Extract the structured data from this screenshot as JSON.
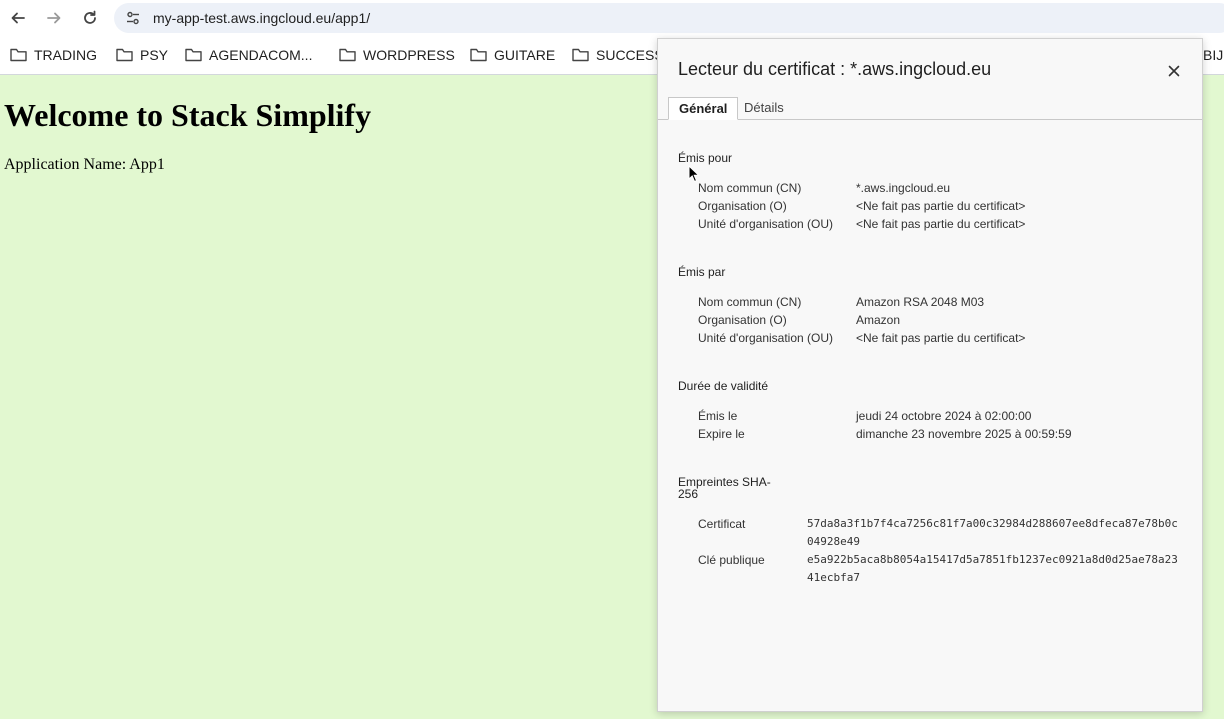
{
  "browser": {
    "url": "my-app-test.aws.ingcloud.eu/app1/",
    "icons": {
      "back": "back-arrow-icon",
      "forward": "forward-arrow-icon",
      "reload": "reload-icon",
      "site_info": "site-info-tune-icon"
    }
  },
  "bookmarks": [
    {
      "label": "TRADING"
    },
    {
      "label": "PSY"
    },
    {
      "label": "AGENDACOM..."
    },
    {
      "label": "WORDPRESS"
    },
    {
      "label": "GUITARE"
    },
    {
      "label": "SUCCESS"
    },
    {
      "label": "BIJ"
    }
  ],
  "page": {
    "heading": "Welcome to Stack Simplify",
    "app_name": "Application Name: App1",
    "background": "#e2f8d0"
  },
  "certificate_dialog": {
    "title": "Lecteur du certificat : *.aws.ingcloud.eu",
    "tabs": [
      {
        "label": "Général",
        "active": true
      },
      {
        "label": "Détails",
        "active": false
      }
    ],
    "issued_to": {
      "title": "Émis pour",
      "rows": [
        {
          "label": "Nom commun (CN)",
          "value": "*.aws.ingcloud.eu"
        },
        {
          "label": "Organisation (O)",
          "value": "<Ne fait pas partie du certificat>"
        },
        {
          "label": "Unité d'organisation (OU)",
          "value": "<Ne fait pas partie du certificat>"
        }
      ]
    },
    "issued_by": {
      "title": "Émis par",
      "rows": [
        {
          "label": "Nom commun (CN)",
          "value": "Amazon RSA 2048 M03"
        },
        {
          "label": "Organisation (O)",
          "value": "Amazon"
        },
        {
          "label": "Unité d'organisation (OU)",
          "value": "<Ne fait pas partie du certificat>"
        }
      ]
    },
    "validity": {
      "title": "Durée de validité",
      "rows": [
        {
          "label": "Émis le",
          "value": "jeudi 24 octobre 2024 à 02:00:00"
        },
        {
          "label": "Expire le",
          "value": "dimanche 23 novembre 2025 à 00:59:59"
        }
      ]
    },
    "fingerprints": {
      "title_line1": "Empreintes SHA-",
      "title_line2": "256",
      "rows": [
        {
          "label": "Certificat",
          "value": "57da8a3f1b7f4ca7256c81f7a00c32984d288607ee8dfeca87e78b0c04928e49"
        },
        {
          "label": "Clé publique",
          "value": "e5a922b5aca8b8054a15417d5a7851fb1237ec0921a8d0d25ae78a2341ecbfa7"
        }
      ]
    }
  }
}
